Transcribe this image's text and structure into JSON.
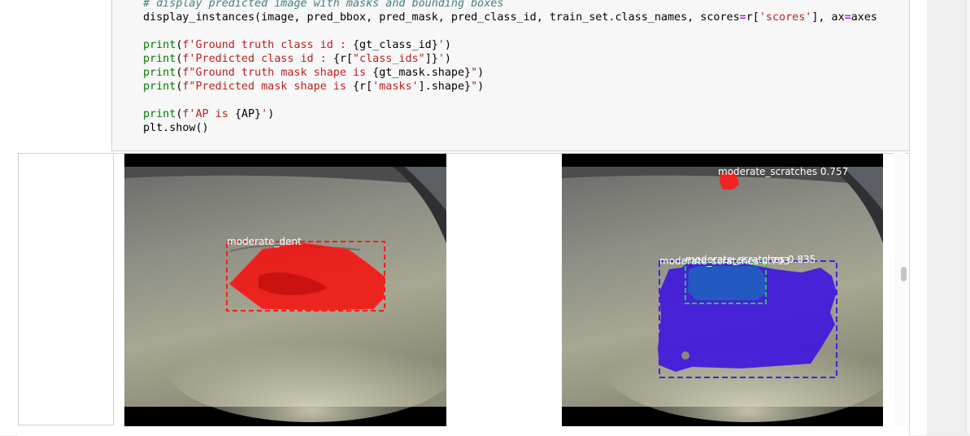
{
  "code_cell": {
    "lines": [
      {
        "type": "comment",
        "text": "# display predicted image with masks and bounding boxes"
      },
      {
        "type": "code",
        "parts": [
          {
            "c": "",
            "t": "display_instances(image, pred_bbox, pred_mask, pred_class_id, train_set.class_names, scores"
          },
          {
            "c": "op",
            "t": "="
          },
          {
            "c": "",
            "t": "r["
          },
          {
            "c": "st",
            "t": "'scores'"
          },
          {
            "c": "",
            "t": "], ax"
          },
          {
            "c": "op",
            "t": "="
          },
          {
            "c": "",
            "t": "axes"
          }
        ]
      },
      {
        "type": "blank"
      },
      {
        "type": "code",
        "parts": [
          {
            "c": "kw",
            "t": "print"
          },
          {
            "c": "",
            "t": "("
          },
          {
            "c": "st",
            "t": "f'Ground truth class id : "
          },
          {
            "c": "",
            "t": "{gt_class_id}"
          },
          {
            "c": "st",
            "t": "'"
          },
          {
            "c": "",
            "t": ")"
          }
        ]
      },
      {
        "type": "code",
        "parts": [
          {
            "c": "kw",
            "t": "print"
          },
          {
            "c": "",
            "t": "("
          },
          {
            "c": "st",
            "t": "f'Predicted class id : "
          },
          {
            "c": "",
            "t": "{r["
          },
          {
            "c": "st",
            "t": "\"class_ids\""
          },
          {
            "c": "",
            "t": "]}"
          },
          {
            "c": "st",
            "t": "'"
          },
          {
            "c": "",
            "t": ")"
          }
        ]
      },
      {
        "type": "code",
        "parts": [
          {
            "c": "kw",
            "t": "print"
          },
          {
            "c": "",
            "t": "("
          },
          {
            "c": "st",
            "t": "f\"Ground truth mask shape is "
          },
          {
            "c": "",
            "t": "{gt_mask.shape}"
          },
          {
            "c": "st",
            "t": "\""
          },
          {
            "c": "",
            "t": ")"
          }
        ]
      },
      {
        "type": "code",
        "parts": [
          {
            "c": "kw",
            "t": "print"
          },
          {
            "c": "",
            "t": "("
          },
          {
            "c": "st",
            "t": "f\"Predicted mask shape is "
          },
          {
            "c": "",
            "t": "{r["
          },
          {
            "c": "st",
            "t": "'masks'"
          },
          {
            "c": "",
            "t": "].shape}"
          },
          {
            "c": "st",
            "t": "\""
          },
          {
            "c": "",
            "t": ")"
          }
        ]
      },
      {
        "type": "blank"
      },
      {
        "type": "code",
        "parts": [
          {
            "c": "kw",
            "t": "print"
          },
          {
            "c": "",
            "t": "("
          },
          {
            "c": "st",
            "t": "f'AP is "
          },
          {
            "c": "",
            "t": "{AP}"
          },
          {
            "c": "st",
            "t": "'"
          },
          {
            "c": "",
            "t": ")"
          }
        ]
      },
      {
        "type": "code",
        "parts": [
          {
            "c": "",
            "t": "plt.show()"
          }
        ]
      }
    ]
  },
  "output": {
    "ground_truth_panel": {
      "labels": [
        {
          "text": "moderate_dent",
          "color": "#ff1a1a"
        }
      ]
    },
    "prediction_panel": {
      "labels": [
        {
          "text": "moderate_scratches 0.757",
          "color": "#ff2a2a"
        },
        {
          "text": "moderate_scratches 0.835",
          "color": "#22cc44"
        },
        {
          "text": "moderate_scratches 0.793",
          "color": "#4422dd"
        }
      ]
    }
  },
  "colors": {
    "dent_mask": "#ff0000",
    "scratch_blue": "#1f5fbf",
    "scratch_purple": "#3a10e0",
    "scratch_green": "#22cc44"
  }
}
